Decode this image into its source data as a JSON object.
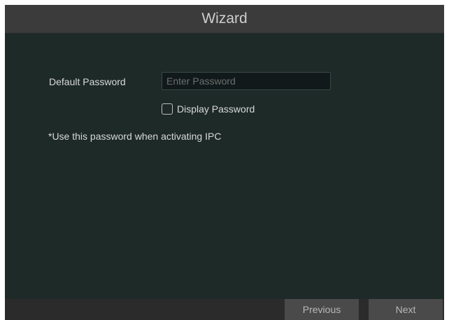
{
  "window": {
    "title": "Wizard"
  },
  "form": {
    "password_label": "Default Password",
    "password_placeholder": "Enter Password",
    "password_value": "",
    "display_password_label": "Display Password",
    "display_password_checked": false,
    "note": "*Use this password when activating IPC"
  },
  "footer": {
    "previous_label": "Previous",
    "next_label": "Next"
  },
  "colors": {
    "content_background": "#1d2a27",
    "titlebar_background": "#3b3b3b",
    "button_background": "#4a4a4a"
  }
}
